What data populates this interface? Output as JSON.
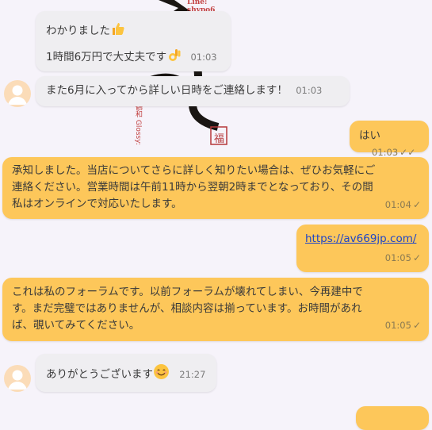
{
  "messages": [
    {
      "line1": "わかりました",
      "line2": "1時間6万円で大丈夫です",
      "time": "01:03"
    },
    {
      "text": "また6月に入ってから詳しい日時をご連絡します！",
      "time": "01:03"
    },
    {
      "text": "はい",
      "time": "01:03"
    },
    {
      "line1": "承知しました。当店についてさらに詳しく知りたい場合は、ぜひお気軽にご",
      "line2": "連絡ください。営業時間は午前11時から翌朝2時までとなっており、その間",
      "line3": "私はオンラインで対応いたします。",
      "time": "01:04"
    },
    {
      "text": "https://av669jp.com/",
      "time": "01:05"
    },
    {
      "line1": "これは私のフォーラムです。以前フォーラムが壊れてしまい、今再建中で",
      "line2": "す。まだ完璧ではありませんが、相談内容は揃っています。お時間があれ",
      "line3": "ば、覗いてみてください。",
      "time": "01:05"
    },
    {
      "text": "ありがとうございます",
      "time": "21:27"
    }
  ],
  "wallpaper": {
    "watermark": "Line: shypo6",
    "side_text": "鶴和 Glossy:",
    "stamp": "福"
  },
  "icons": {
    "thumbs_up": "thumbs-up-emoji",
    "ok_hand": "ok-hand-emoji",
    "smile": "smiling-face-emoji",
    "read": "double-check-icon",
    "sent": "check-icon"
  },
  "colors": {
    "incoming": "#efeef1",
    "outgoing": "#fdc75a",
    "background": "#f6f3fa",
    "link": "#1e45c8"
  }
}
